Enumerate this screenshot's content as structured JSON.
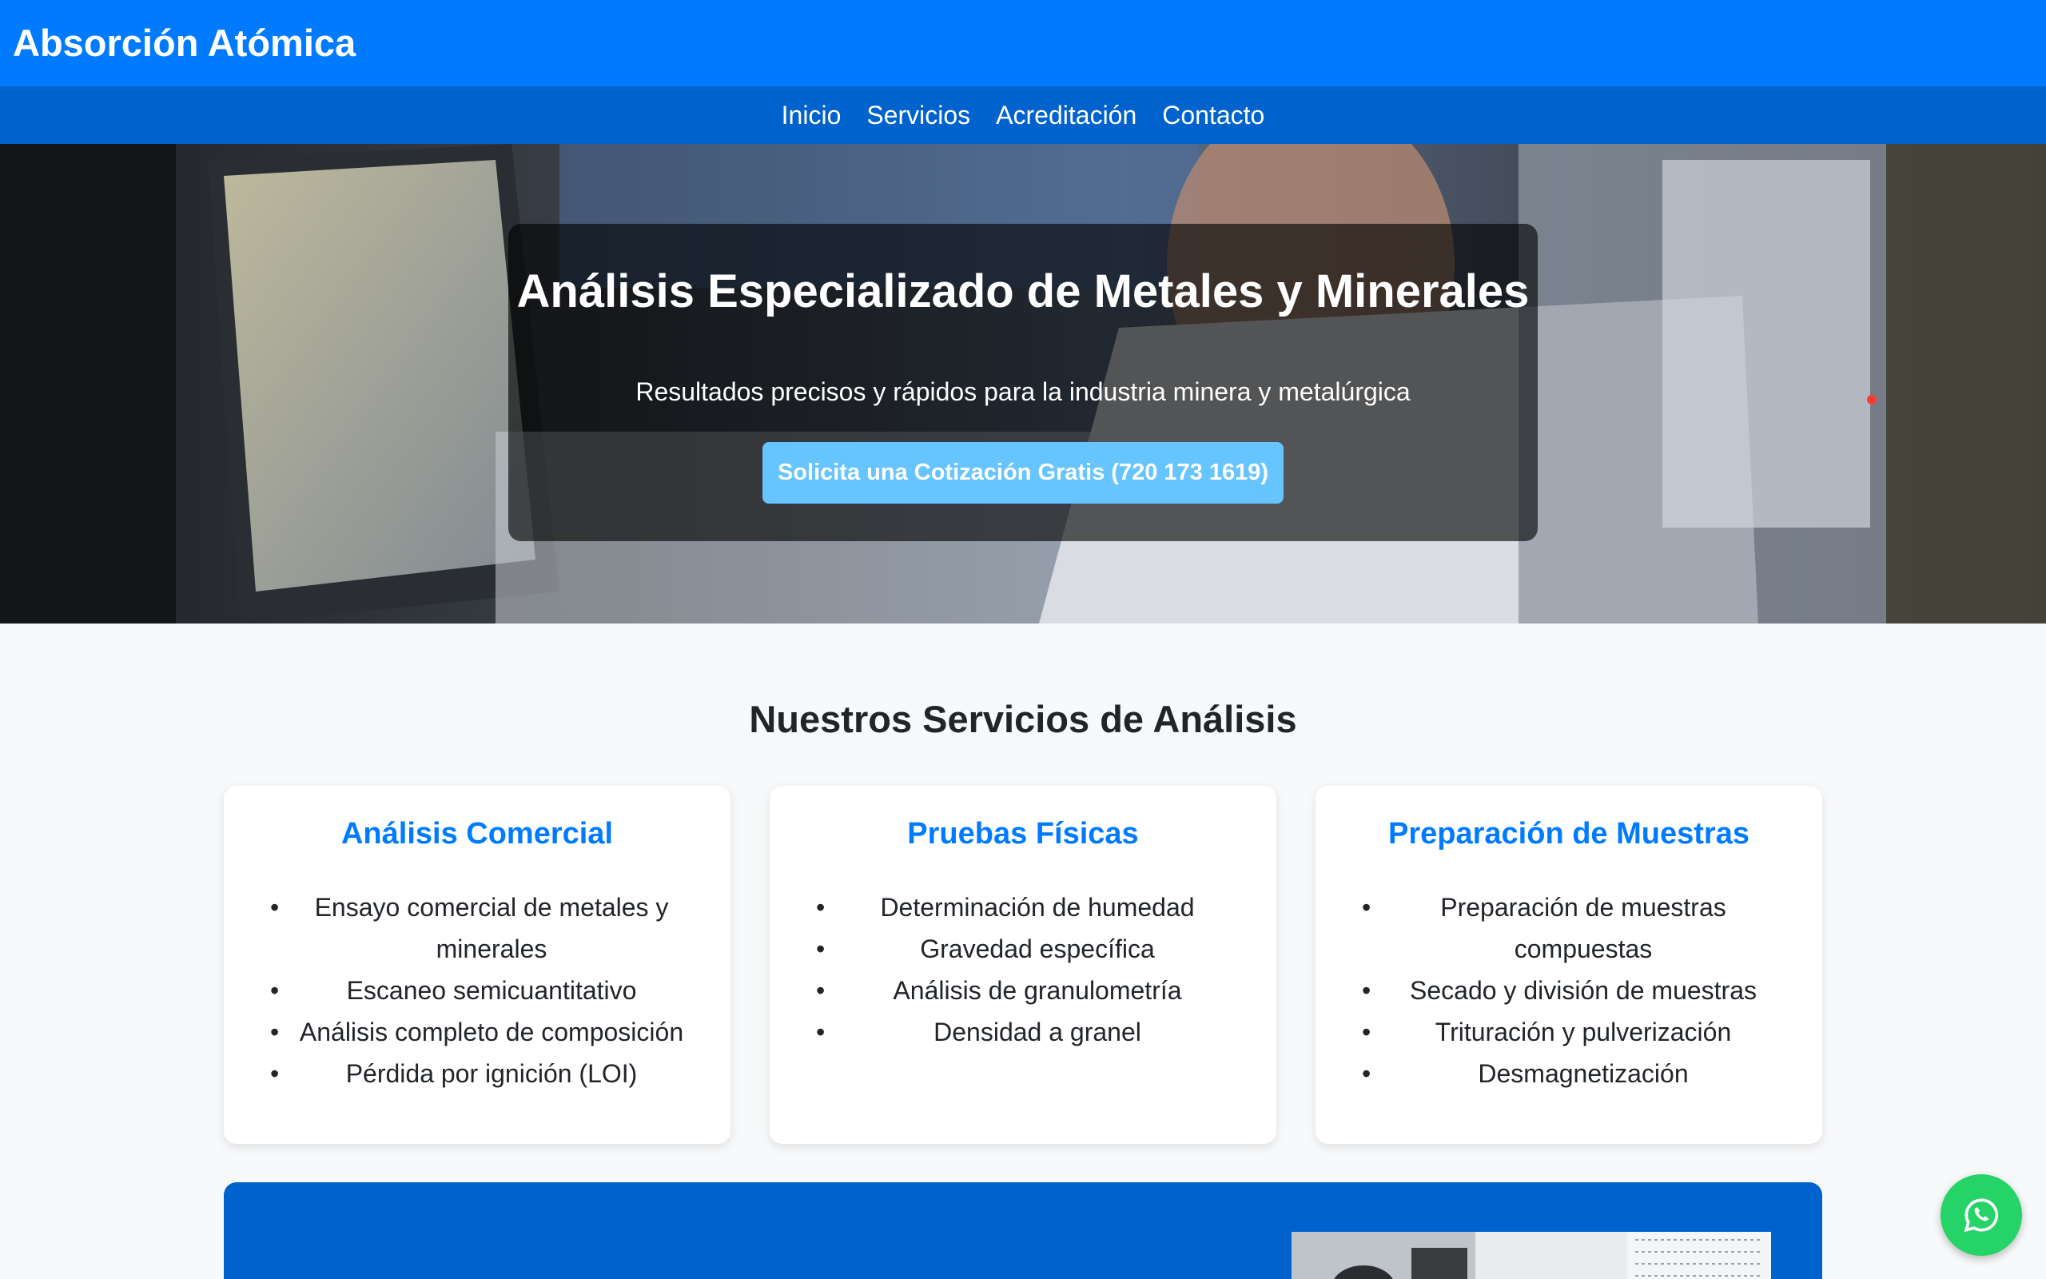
{
  "header": {
    "brand": "Absorción Atómica"
  },
  "nav": {
    "items": [
      "Inicio",
      "Servicios",
      "Acreditación",
      "Contacto"
    ]
  },
  "hero": {
    "title": "Análisis Especializado de Metales y Minerales",
    "subtitle": "Resultados precisos y rápidos para la industria minera y metalúrgica",
    "cta_label": "Solicita una Cotización Gratis (720 173 1619)"
  },
  "services": {
    "title": "Nuestros Servicios de Análisis",
    "cards": [
      {
        "title": "Análisis Comercial",
        "items": [
          "Ensayo comercial de metales y minerales",
          "Escaneo semicuantitativo",
          "Análisis completo de composición",
          "Pérdida por ignición (LOI)"
        ]
      },
      {
        "title": "Pruebas Físicas",
        "items": [
          "Determinación de humedad",
          "Gravedad específica",
          "Análisis de granulometría",
          "Densidad a granel"
        ]
      },
      {
        "title": "Preparación de Muestras",
        "items": [
          "Preparación de muestras compuestas",
          "Secado y división de muestras",
          "Trituración y pulverización",
          "Desmagnetización"
        ]
      }
    ]
  },
  "floating": {
    "icon": "whatsapp-icon"
  },
  "colors": {
    "primary": "#007bff",
    "nav": "#0062cc",
    "cta": "#66c4ff",
    "card_title": "#007bff",
    "whatsapp": "#25d366"
  }
}
